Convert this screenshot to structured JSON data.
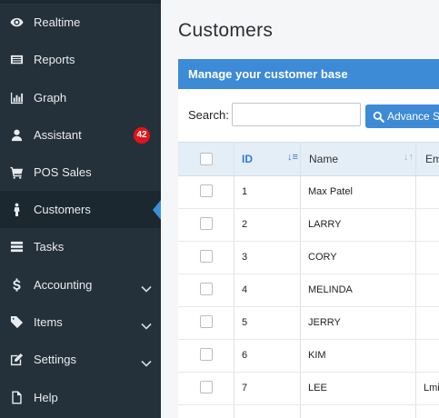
{
  "sidebar": {
    "items": [
      {
        "label": "Realtime",
        "icon": "eye-icon"
      },
      {
        "label": "Reports",
        "icon": "list-icon"
      },
      {
        "label": "Graph",
        "icon": "bar-chart-icon"
      },
      {
        "label": "Assistant",
        "icon": "user-icon",
        "badge": "42"
      },
      {
        "label": "POS Sales",
        "icon": "cart-icon"
      },
      {
        "label": "Customers",
        "icon": "person-icon",
        "active": true
      },
      {
        "label": "Tasks",
        "icon": "tasks-icon"
      },
      {
        "label": "Accounting",
        "icon": "dollar-icon",
        "expandable": true
      },
      {
        "label": "Items",
        "icon": "tag-icon",
        "expandable": true
      },
      {
        "label": "Settings",
        "icon": "edit-icon",
        "expandable": true
      },
      {
        "label": "Help",
        "icon": "document-icon"
      }
    ]
  },
  "main": {
    "title": "Customers",
    "panel_title": "Manage your customer base",
    "search_label": "Search:",
    "search_value": "",
    "advance_button": "Advance S"
  },
  "table": {
    "columns": [
      "ID",
      "Name",
      "Em"
    ],
    "rows": [
      {
        "id": "1",
        "name": "Max Patel",
        "email": ""
      },
      {
        "id": "2",
        "name": "LARRY",
        "email": ""
      },
      {
        "id": "3",
        "name": "CORY",
        "email": ""
      },
      {
        "id": "4",
        "name": "MELINDA",
        "email": ""
      },
      {
        "id": "5",
        "name": "JERRY",
        "email": ""
      },
      {
        "id": "6",
        "name": "KIM",
        "email": ""
      },
      {
        "id": "7",
        "name": "LEE",
        "email": "Lmi"
      }
    ]
  },
  "colors": {
    "sidebar_bg": "#24313b",
    "accent": "#3d8ad6",
    "badge": "#e2141a",
    "header_bg": "#e4eef7"
  }
}
